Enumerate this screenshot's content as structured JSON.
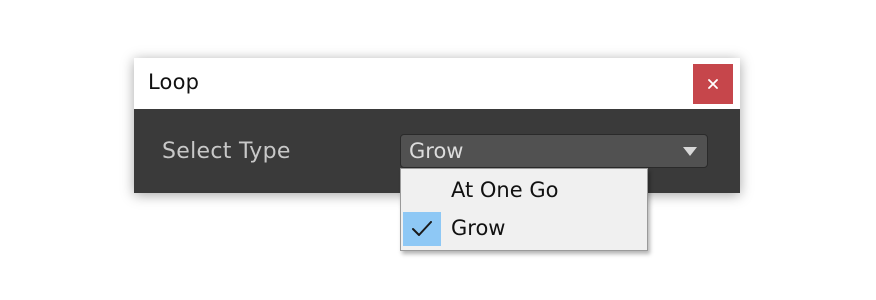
{
  "dialog": {
    "title": "Loop",
    "close_icon": "close-icon",
    "close_color": "#c6464b"
  },
  "form": {
    "label": "Select Type",
    "select_value": "Grow",
    "arrow_icon": "triangle-down-icon"
  },
  "dropdown": {
    "options": [
      {
        "label": "At One Go",
        "selected": false
      },
      {
        "label": "Grow",
        "selected": true
      }
    ],
    "check_icon": "checkmark-icon",
    "highlight_color": "#8ec8f5"
  }
}
